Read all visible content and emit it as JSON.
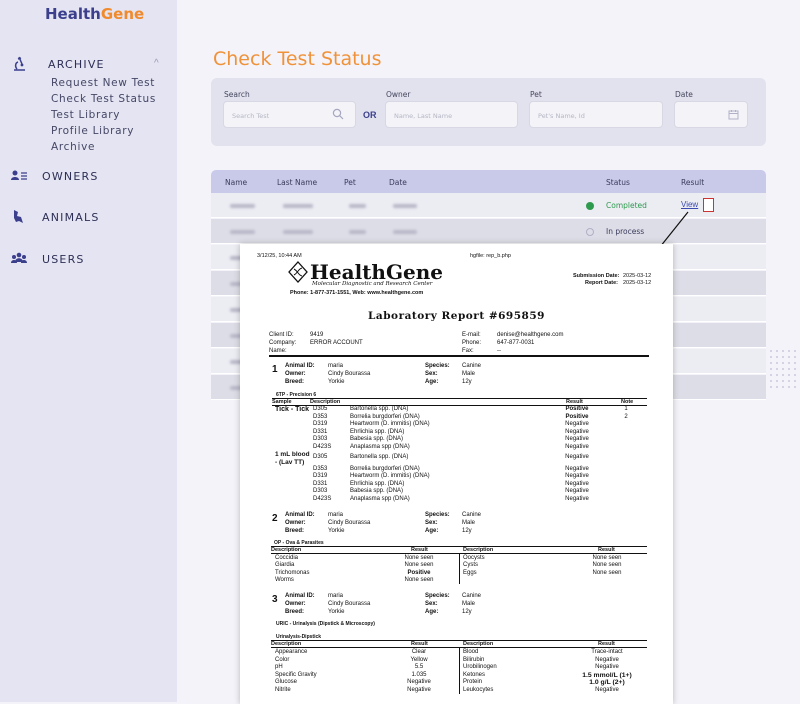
{
  "app": {
    "brand_part1": "Health",
    "brand_part2": "Gene"
  },
  "sidebar": {
    "archive": {
      "label": "ARCHIVE",
      "items": [
        "Request New Test",
        "Check Test Status",
        "Test Library",
        "Profile Library",
        "Archive"
      ]
    },
    "owners": "OWNERS",
    "animals": "ANIMALS",
    "users": "USERS"
  },
  "main": {
    "title": "Check Test Status"
  },
  "search": {
    "search_label": "Search",
    "search_placeholder": "Search Test",
    "or_label": "OR",
    "owner_label": "Owner",
    "owner_placeholder": "Name, Last Name",
    "pet_label": "Pet",
    "pet_placeholder": "Pet's Name, Id",
    "date_label": "Date"
  },
  "table": {
    "headers": [
      "Name",
      "Last Name",
      "Pet",
      "Date",
      "Status",
      "Result"
    ],
    "rows": [
      {
        "status": "Completed",
        "result": "View"
      },
      {
        "status": "In process"
      }
    ]
  },
  "report": {
    "timestamp": "3/12/25, 10:44 AM",
    "file": "hgfile: rep_b.php",
    "company_name": "HealthGene",
    "company_sub": "Molecular Diagnostic and Research Center",
    "company_contact": "Phone: 1-877-371-1551, Web: www.healthgene.com",
    "submission_date_label": "Submission Date:",
    "submission_date": "2025-03-12",
    "report_date_label": "Report Date:",
    "report_date": "2025-03-12",
    "title": "Laboratory Report #695859",
    "client_id_label": "Client ID:",
    "client_id": "9419",
    "company_label": "Company:",
    "company": "ERROR ACCOUNT",
    "name_label": "Name:",
    "email_label": "E-mail:",
    "email": "denise@healthgene.com",
    "phone_label": "Phone:",
    "phone": "647-877-0031",
    "fax_label": "Fax:",
    "fax": "--",
    "animals": [
      {
        "num": "1",
        "id": "maria",
        "owner": "Cindy Bourassa",
        "breed": "Yorkie",
        "species": "Canine",
        "sex": "Male",
        "age": "12y"
      },
      {
        "num": "2",
        "id": "maria",
        "owner": "Cindy Bourassa",
        "breed": "Yorkie",
        "species": "Canine",
        "sex": "Male",
        "age": "12y"
      },
      {
        "num": "3",
        "id": "maria",
        "owner": "Cindy Bourassa",
        "breed": "Yorkie",
        "species": "Canine",
        "sex": "Male",
        "age": "12y"
      }
    ],
    "labels": {
      "animal_id": "Animal ID:",
      "owner": "Owner:",
      "breed": "Breed:",
      "species": "Species:",
      "sex": "Sex:",
      "age": "Age:"
    },
    "panel1": {
      "title": "6TP - Precision 6",
      "headers": [
        "Sample",
        "Description",
        "Result",
        "Note"
      ],
      "sample1": "Tick - Tick",
      "sample2a": "1 mL blood",
      "sample2b": "- (Lav TT)",
      "rows1": [
        [
          "D305",
          "Bartonella spp. (DNA)",
          "Positive",
          "1"
        ],
        [
          "D353",
          "Borrelia burgdorferi (DNA)",
          "Positive",
          "2"
        ],
        [
          "D319",
          "Heartworm (D. immitis) (DNA)",
          "Negative",
          ""
        ],
        [
          "D331",
          "Ehrlichia spp. (DNA)",
          "Negative",
          ""
        ],
        [
          "D303",
          "Babesia spp. (DNA)",
          "Negative",
          ""
        ],
        [
          "D423S",
          "Anaplasma spp (DNA)",
          "Negative",
          ""
        ]
      ],
      "rows2": [
        [
          "D305",
          "Bartonella spp. (DNA)",
          "Negative"
        ],
        [
          "D353",
          "Borrelia burgdorferi (DNA)",
          "Negative"
        ],
        [
          "D319",
          "Heartworm (D. immitis) (DNA)",
          "Negative"
        ],
        [
          "D331",
          "Ehrlichia spp. (DNA)",
          "Negative"
        ],
        [
          "D303",
          "Babesia spp. (DNA)",
          "Negative"
        ],
        [
          "D423S",
          "Anaplasma spp (DNA)",
          "Negative"
        ]
      ]
    },
    "panel2": {
      "title": "OP - Ova & Parasites",
      "headers": [
        "Description",
        "Result",
        "Description",
        "Result"
      ],
      "left": [
        [
          "Coccidia",
          "None seen"
        ],
        [
          "Giardia",
          "None seen"
        ],
        [
          "Trichomonas",
          "Positive"
        ],
        [
          "Worms",
          "None seen"
        ]
      ],
      "right": [
        [
          "Oocysts",
          "None seen"
        ],
        [
          "Cysts",
          "None seen"
        ],
        [
          "Eggs",
          "None seen"
        ]
      ]
    },
    "panel3": {
      "title": "URIC - Urinalysis (Dipstick & Microscopy)",
      "subtitle": "Urinalysis-Dipstick",
      "headers": [
        "Description",
        "Result",
        "Description",
        "Result"
      ],
      "left": [
        [
          "Appearance",
          "Clear"
        ],
        [
          "Color",
          "Yellow"
        ],
        [
          "pH",
          "5.5"
        ],
        [
          "Specific Gravity",
          "1.035"
        ],
        [
          "Glucose",
          "Negative"
        ],
        [
          "Nitrite",
          "Negative"
        ]
      ],
      "right": [
        [
          "Blood",
          "Trace-intact"
        ],
        [
          "Bilirubin",
          "Negative"
        ],
        [
          "Urobilinogen",
          "Negative"
        ],
        [
          "Ketones",
          "1.5 mmol/L (1+)"
        ],
        [
          "Protein",
          "1.0 g/L (2+)"
        ],
        [
          "Leukocytes",
          "Negative"
        ]
      ]
    }
  },
  "colors": {
    "accent": "#f0923a",
    "brand": "#3b3f8c",
    "completed": "#2e9a4e",
    "sidebar": "#e4e4f2"
  },
  "icons": [
    "microscope-icon",
    "owners-icon",
    "animals-icon",
    "users-icon",
    "search-icon",
    "calendar-icon",
    "pdf-icon",
    "check-circle-icon",
    "clock-icon"
  ]
}
